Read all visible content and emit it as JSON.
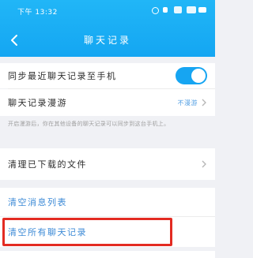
{
  "status_bar": {
    "time": "下午 13:32"
  },
  "header": {
    "title": "聊天记录"
  },
  "rows": {
    "sync": {
      "label": "同步最近聊天记录至手机",
      "enabled": true
    },
    "roaming": {
      "label": "聊天记录漫游",
      "value": "不漫游"
    },
    "note": "开启漫游后，你在其他设备的聊天记录可以同步到这台手机上。",
    "clear_downloaded": {
      "label": "清理已下载的文件"
    },
    "clear_message_list": {
      "label": "清空消息列表"
    },
    "clear_all_chat": {
      "label": "清空所有聊天记录"
    }
  },
  "colors": {
    "header": "#1aaef5",
    "accent_blue": "#3c8ad6",
    "toggle_on": "#16a5f2",
    "highlight_red": "#e32b22"
  },
  "icons": [
    "back-arrow-icon",
    "chevron-right-icon",
    "toggle-switch"
  ]
}
